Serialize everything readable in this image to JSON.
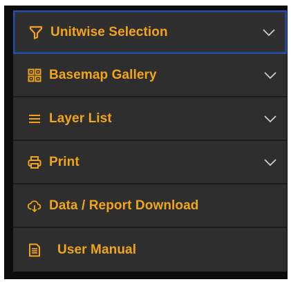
{
  "menu": {
    "items": [
      {
        "label": "Unitwise Selection",
        "icon": "filter-icon",
        "expandable": true,
        "selected": true
      },
      {
        "label": "Basemap Gallery",
        "icon": "grid-icon",
        "expandable": true
      },
      {
        "label": "Layer List",
        "icon": "list-icon",
        "expandable": true
      },
      {
        "label": "Print",
        "icon": "printer-icon",
        "expandable": true
      },
      {
        "label": "Data / Report Download",
        "icon": "cloud-download-icon",
        "expandable": false
      },
      {
        "label": "User Manual",
        "icon": "document-icon",
        "expandable": false
      }
    ]
  },
  "colors": {
    "accent": "#f2a51a",
    "item_bg": "#2e2e2e",
    "selected_border": "#2a4fa6",
    "chevron": "#cfcfcf"
  }
}
